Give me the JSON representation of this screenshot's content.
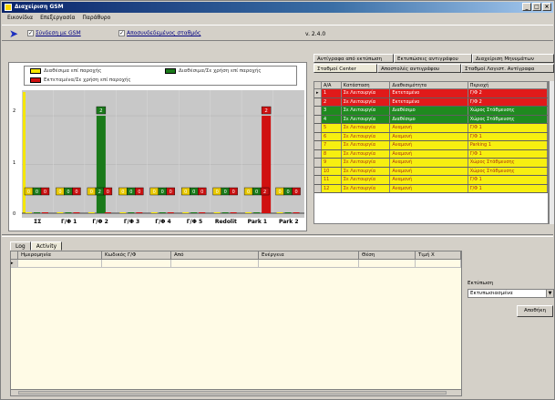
{
  "window": {
    "title": "Διαχείριση GSM",
    "controls": [
      "_",
      "□",
      "×"
    ]
  },
  "menu": [
    "Εικονίδια",
    "Επεξεργασία",
    "Παράθυρο"
  ],
  "toolbar": {
    "check1_label": "Σύνδεση με GSM",
    "check2_label": "Αποσυνδεδεμένος σταθμός",
    "version": "v. 2.4.0"
  },
  "legend": [
    {
      "label": "Διαθέσιμα επί παροχής",
      "color": "#f5e600"
    },
    {
      "label": "Διαθέσιμα/Σε χρήση επί παροχής",
      "color": "#1a7a1a"
    },
    {
      "label": "Εκτεταμένα/Σε χρήση επί παροχής",
      "color": "#d01010"
    }
  ],
  "chart_data": {
    "type": "bar",
    "categories": [
      "ΣΣ",
      "Γ/Φ 1",
      "Γ/Φ 2",
      "Γ/Φ 3",
      "Γ/Φ 4",
      "Γ/Φ 5",
      "Redolit",
      "Park 1",
      "Park 2"
    ],
    "series": [
      {
        "name": "Διαθέσιμα επί παροχής",
        "color": "#f5e600",
        "values": [
          0,
          0,
          0,
          0,
          0,
          0,
          0,
          0,
          0
        ]
      },
      {
        "name": "Διαθέσιμα/Σε χρήση επί παροχής",
        "color": "#1a7a1a",
        "values": [
          0,
          0,
          2,
          0,
          0,
          0,
          0,
          0,
          0
        ]
      },
      {
        "name": "Εκτεταμένα/Σε χρήση επί παροχής",
        "color": "#d01010",
        "values": [
          0,
          0,
          0,
          0,
          0,
          0,
          0,
          2,
          0
        ]
      }
    ],
    "top_labels": [
      "0",
      "0",
      "2",
      "0",
      "0",
      "0",
      "0",
      "2",
      "0"
    ],
    "ylim": [
      0,
      2.3
    ],
    "yticks": [
      "0",
      "1",
      "2"
    ]
  },
  "right_tabs": [
    "Αντίγραφα από εκτύπωση",
    "Εκτυπώσεις αντιγράφου",
    "Διαχείριση Μηνυμάτων",
    "Σταθμοί Center",
    "Αποστολές αντιγράφου",
    "Σταθμοί Λογιστ. Αντίγραφα"
  ],
  "grid": {
    "headers": [
      "",
      "Α/Α",
      "Κατάσταση",
      "Διαθεσιμότητα",
      "Περιοχή"
    ],
    "rows": [
      {
        "id": "1",
        "status": "Σε Λειτουργία",
        "avail": "Εκτεταμένο",
        "area": "Γ/Φ 2",
        "color": "#e01a1a"
      },
      {
        "id": "2",
        "status": "Σε Λειτουργία",
        "avail": "Εκτεταμένο",
        "area": "Γ/Φ 2",
        "color": "#e01a1a"
      },
      {
        "id": "3",
        "status": "Σε Λειτουργία",
        "avail": "Διαθέσιμο",
        "area": "Χώρος Στάθμευσης",
        "color": "#1f8a1f"
      },
      {
        "id": "4",
        "status": "Σε Λειτουργία",
        "avail": "Διαθέσιμο",
        "area": "Χώρος Στάθμευσης",
        "color": "#1f8a1f"
      },
      {
        "id": "5",
        "status": "Σε Λειτουργία",
        "avail": "Αναμονή",
        "area": "Γ/Φ 1",
        "color": "#f7ef10"
      },
      {
        "id": "6",
        "status": "Σε Λειτουργία",
        "avail": "Αναμονή",
        "area": "Γ/Φ 1",
        "color": "#f7ef10"
      },
      {
        "id": "7",
        "status": "Σε Λειτουργία",
        "avail": "Αναμονή",
        "area": "Parking 1",
        "color": "#f7ef10"
      },
      {
        "id": "8",
        "status": "Σε Λειτουργία",
        "avail": "Αναμονή",
        "area": "Γ/Φ 1",
        "color": "#f7ef10"
      },
      {
        "id": "9",
        "status": "Σε Λειτουργία",
        "avail": "Αναμονή",
        "area": "Χώρος Στάθμευσης",
        "color": "#f7ef10"
      },
      {
        "id": "10",
        "status": "Σε Λειτουργία",
        "avail": "Αναμονή",
        "area": "Χώρος Στάθμευσης",
        "color": "#f7ef10"
      },
      {
        "id": "11",
        "status": "Σε Λειτουργία",
        "avail": "Αναμονή",
        "area": "Γ/Φ 1",
        "color": "#f7ef10"
      },
      {
        "id": "12",
        "status": "Σε Λειτουργία",
        "avail": "Αναμονή",
        "area": "Γ/Φ 1",
        "color": "#f7ef10"
      }
    ]
  },
  "bottom_tabs": [
    "Log",
    "Activity"
  ],
  "log": {
    "headers": [
      "Ημερομηνία",
      "Κωδικός Γ/Φ",
      "Από",
      "Ενέργεια",
      "Θέση",
      "Τιμή Χ"
    ]
  },
  "filter": {
    "label": "Εκτύπωση",
    "selected": "Εκτυπωσιασμένα",
    "button": "Αποθήκη"
  }
}
